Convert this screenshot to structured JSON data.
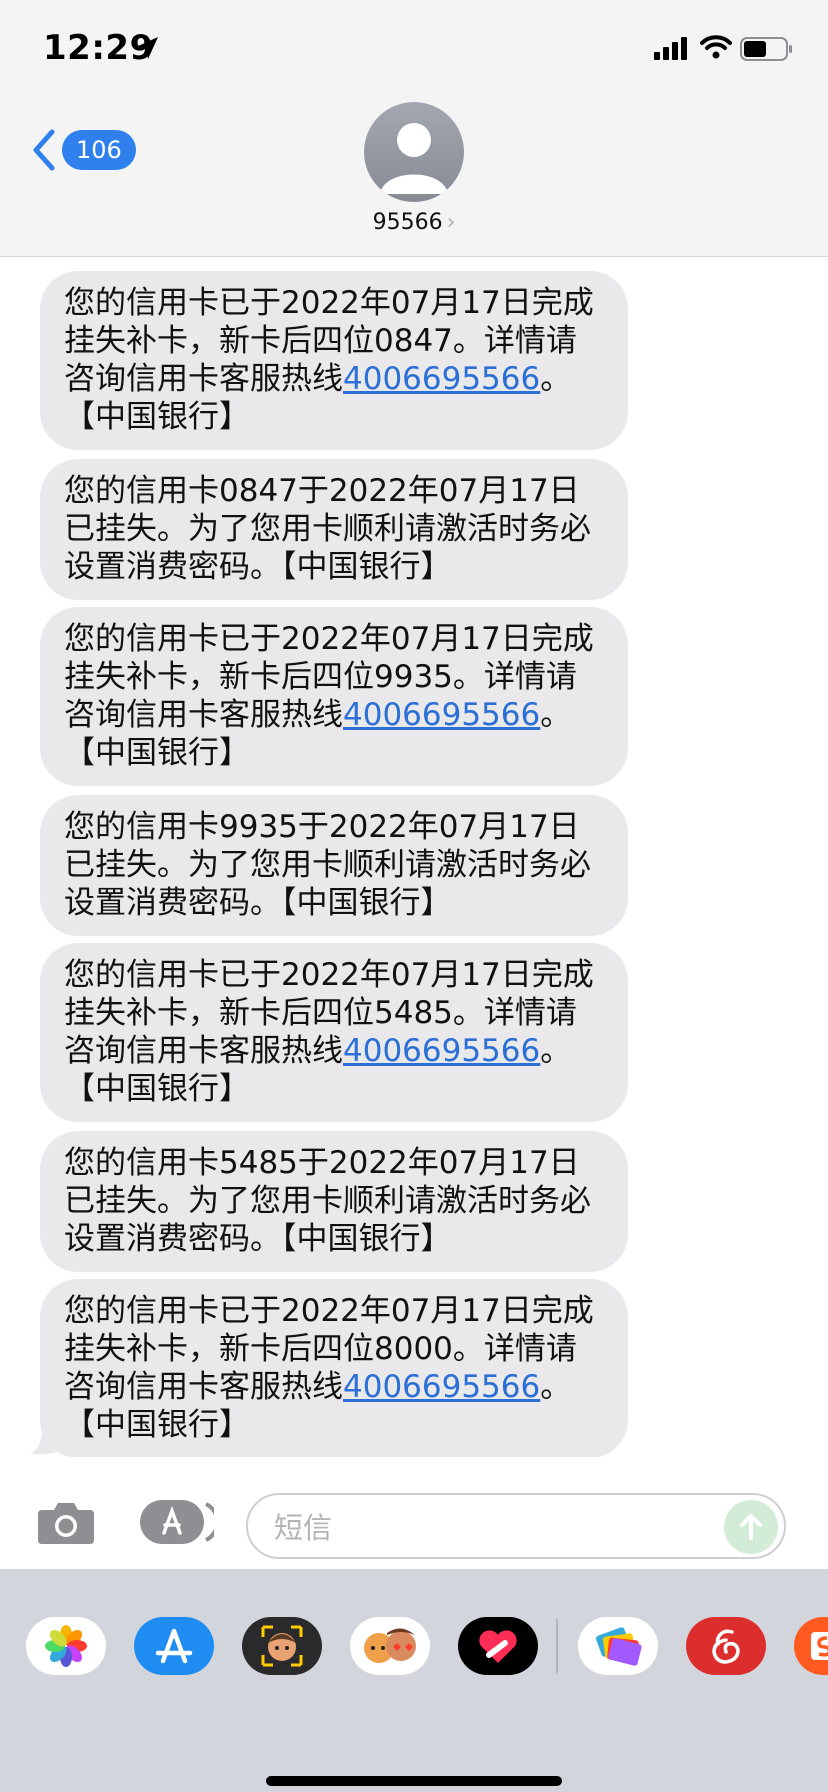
{
  "status_bar": {
    "time": "12:29",
    "icons": [
      "location-arrow-icon",
      "signal-icon",
      "wifi-icon",
      "battery-icon"
    ]
  },
  "header": {
    "back_badge": "106",
    "contact_name": "95566",
    "chevron": "›"
  },
  "messages": [
    {
      "text": "您的信用卡已于2022年07月17日完成挂失补卡，新卡后四位0847。详情请咨询信用卡客服热线",
      "phone": "4006695566",
      "suffix": "。【中国银行】"
    },
    {
      "text": "您的信用卡0847于2022年07月17日已挂失。为了您用卡顺利请激活时务必设置消费密码。【中国银行】"
    },
    {
      "text": "您的信用卡已于2022年07月17日完成挂失补卡，新卡后四位9935。详情请咨询信用卡客服热线",
      "phone": "4006695566",
      "suffix": "。【中国银行】"
    },
    {
      "text": "您的信用卡9935于2022年07月17日已挂失。为了您用卡顺利请激活时务必设置消费密码。【中国银行】"
    },
    {
      "text": "您的信用卡已于2022年07月17日完成挂失补卡，新卡后四位5485。详情请咨询信用卡客服热线",
      "phone": "4006695566",
      "suffix": "。【中国银行】"
    },
    {
      "text": "您的信用卡5485于2022年07月17日已挂失。为了您用卡顺利请激活时务必设置消费密码。【中国银行】"
    },
    {
      "text": "您的信用卡已于2022年07月17日完成挂失补卡，新卡后四位8000。详情请咨询信用卡客服热线",
      "phone": "4006695566",
      "suffix": "。【中国银行】"
    }
  ],
  "input": {
    "placeholder": "短信"
  },
  "drawer_apps": [
    "photos-icon",
    "app-store-icon",
    "memoji-icon",
    "animoji-icon",
    "digital-touch-icon",
    "wallet-icon",
    "netease-music-icon",
    "app-icon"
  ],
  "colors": {
    "link": "#2b6fd6",
    "badge": "#2f80ed",
    "bubble": "#e9e9eb"
  }
}
